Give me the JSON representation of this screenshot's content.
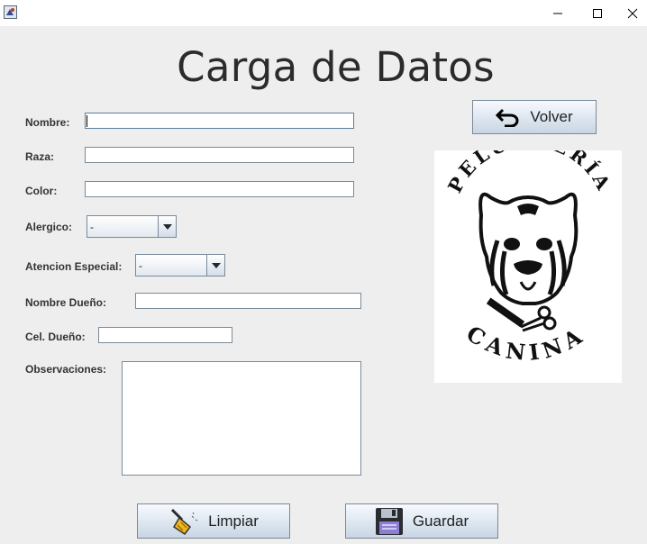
{
  "window": {
    "icon": "java-app-icon",
    "controls": [
      "minimize-icon",
      "maximize-icon",
      "close-icon"
    ]
  },
  "heading": "Carga de Datos",
  "form": {
    "nombre": {
      "label": "Nombre:",
      "value": ""
    },
    "raza": {
      "label": "Raza:",
      "value": ""
    },
    "color": {
      "label": "Color:",
      "value": ""
    },
    "alergico": {
      "label": "Alergico:",
      "selected": "-"
    },
    "atencion_especial": {
      "label": "Atencion Especial:",
      "selected": "-"
    },
    "nombre_dueno": {
      "label": "Nombre Dueño:",
      "value": ""
    },
    "cel_dueno": {
      "label": "Cel. Dueño:",
      "value": ""
    },
    "observaciones": {
      "label": "Observaciones:",
      "value": ""
    }
  },
  "buttons": {
    "volver": {
      "label": "Volver",
      "icon": "undo-arrow-icon"
    },
    "limpiar": {
      "label": "Limpiar",
      "icon": "broom-icon"
    },
    "guardar": {
      "label": "Guardar",
      "icon": "floppy-disk-icon"
    }
  },
  "logo": {
    "icon": "peluqueria-canina-logo",
    "text_top": "PELUQUERÍA",
    "text_bottom": "CANINA"
  },
  "colors": {
    "background": "#eeeeee",
    "button_gradient_top": "#f7fafd",
    "button_gradient_bottom": "#c8d5e3",
    "border": "#7a8a99"
  }
}
